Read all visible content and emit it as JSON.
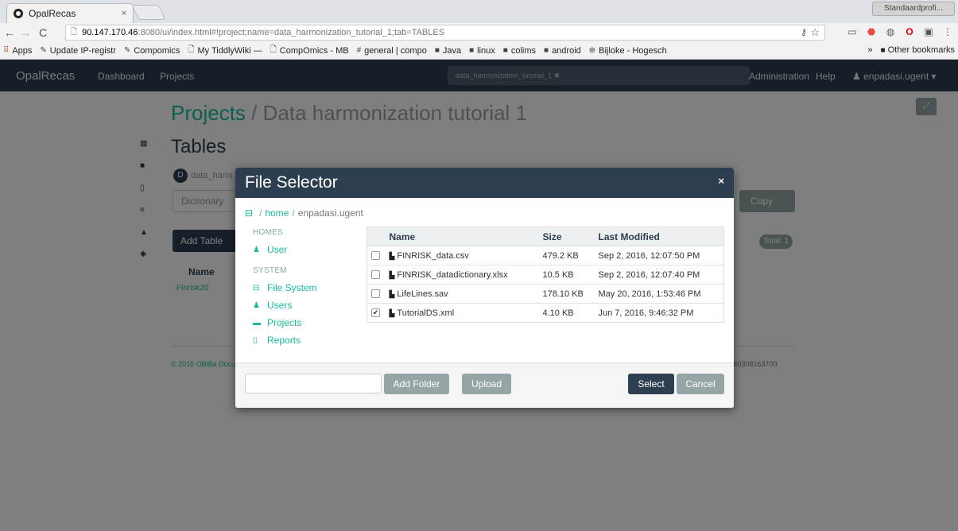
{
  "browser": {
    "tab_title": "OpalRecas",
    "tab_close": "×",
    "profile": "Standaardprofi...",
    "url_host": "90.147.170.46",
    "url_rest": ":8080/ui/index.html#!project;name=data_harmonization_tutorial_1;tab=TABLES",
    "bookmarks": [
      {
        "label": "Apps",
        "icon": "apps-grid-icon"
      },
      {
        "label": "Update IP-registr",
        "icon": "bookmark-icon"
      },
      {
        "label": "Compomics",
        "icon": "bookmark-icon"
      },
      {
        "label": "My TiddlyWiki —",
        "icon": "page-icon"
      },
      {
        "label": "CompOmics - MB",
        "icon": "page-icon"
      },
      {
        "label": "general | compo",
        "icon": "slack-icon"
      },
      {
        "label": "Java",
        "icon": "folder-icon"
      },
      {
        "label": "linux",
        "icon": "folder-icon"
      },
      {
        "label": "colims",
        "icon": "folder-icon"
      },
      {
        "label": "android",
        "icon": "folder-icon"
      },
      {
        "label": "Bijloke - Hogesch",
        "icon": "globe-icon"
      }
    ],
    "bookmarks_overflow": "»",
    "other_bookmarks": "Other bookmarks"
  },
  "app": {
    "brand": "OpalRecas",
    "nav": [
      "Dashboard",
      "Projects"
    ],
    "project_search": "data_harmonization_tutorial_1",
    "nav_right": [
      "Administration",
      "Help",
      "enpadasi.ugent"
    ],
    "breadcrumb_projects": "Projects",
    "breadcrumb_current": "/ Data harmonization tutorial 1",
    "section_title": "Tables",
    "datasource_label": "data_harm",
    "dictionary_label": "Dictionary",
    "add_table": "Add Table",
    "copy": "Copy",
    "total": "Total: 1",
    "table_col_name": "Name",
    "table_row_name": "Finrisk20",
    "footer_links": "© 2016 OBiBa  Documentation  Sources",
    "version": "2.4.11-b20160308163700"
  },
  "modal": {
    "title": "File Selector",
    "close": "×",
    "breadcrumb": {
      "home": "home",
      "current": "enpadasi.ugent"
    },
    "sidebar": {
      "homes_header": "HOMES",
      "user": "User",
      "system_header": "SYSTEM",
      "items": [
        "File System",
        "Users",
        "Projects",
        "Reports"
      ]
    },
    "table": {
      "headers": [
        "Name",
        "Size",
        "Last Modified"
      ],
      "rows": [
        {
          "name": "FINRISK_data.csv",
          "size": "479.2 KB",
          "modified": "Sep 2, 2016, 12:07:50 PM",
          "checked": false
        },
        {
          "name": "FINRISK_datadictionary.xlsx",
          "size": "10.5 KB",
          "modified": "Sep 2, 2016, 12:07:40 PM",
          "checked": false
        },
        {
          "name": "LifeLines.sav",
          "size": "178.10 KB",
          "modified": "May 20, 2016, 1:53:46 PM",
          "checked": false
        },
        {
          "name": "TutorialDS.xml",
          "size": "4.10 KB",
          "modified": "Jun 7, 2016, 9:46:32 PM",
          "checked": true
        }
      ]
    },
    "folder_input_value": "",
    "add_folder": "Add Folder",
    "upload": "Upload",
    "select": "Select",
    "cancel": "Cancel"
  }
}
